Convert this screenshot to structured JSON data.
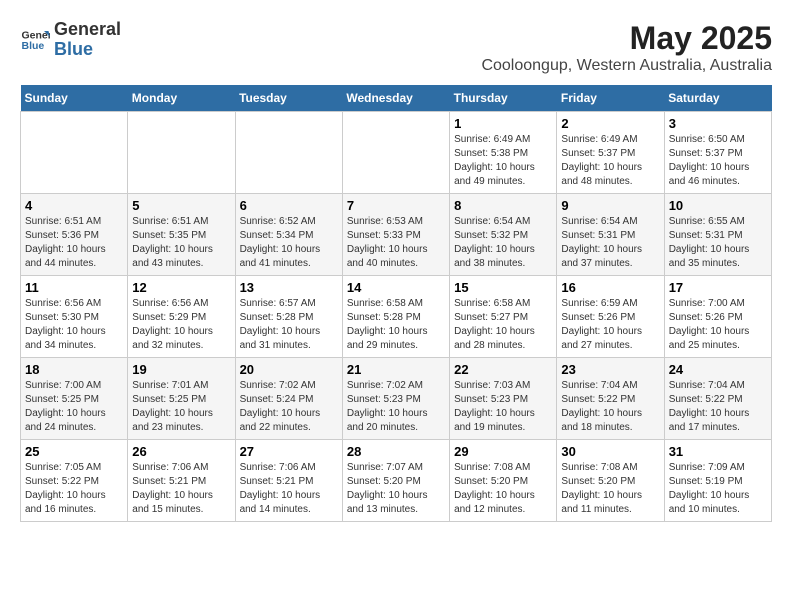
{
  "header": {
    "logo_line1": "General",
    "logo_line2": "Blue",
    "title": "May 2025",
    "subtitle": "Cooloongup, Western Australia, Australia"
  },
  "weekdays": [
    "Sunday",
    "Monday",
    "Tuesday",
    "Wednesday",
    "Thursday",
    "Friday",
    "Saturday"
  ],
  "weeks": [
    [
      {
        "day": "",
        "info": ""
      },
      {
        "day": "",
        "info": ""
      },
      {
        "day": "",
        "info": ""
      },
      {
        "day": "",
        "info": ""
      },
      {
        "day": "1",
        "info": "Sunrise: 6:49 AM\nSunset: 5:38 PM\nDaylight: 10 hours and 49 minutes."
      },
      {
        "day": "2",
        "info": "Sunrise: 6:49 AM\nSunset: 5:37 PM\nDaylight: 10 hours and 48 minutes."
      },
      {
        "day": "3",
        "info": "Sunrise: 6:50 AM\nSunset: 5:37 PM\nDaylight: 10 hours and 46 minutes."
      }
    ],
    [
      {
        "day": "4",
        "info": "Sunrise: 6:51 AM\nSunset: 5:36 PM\nDaylight: 10 hours and 44 minutes."
      },
      {
        "day": "5",
        "info": "Sunrise: 6:51 AM\nSunset: 5:35 PM\nDaylight: 10 hours and 43 minutes."
      },
      {
        "day": "6",
        "info": "Sunrise: 6:52 AM\nSunset: 5:34 PM\nDaylight: 10 hours and 41 minutes."
      },
      {
        "day": "7",
        "info": "Sunrise: 6:53 AM\nSunset: 5:33 PM\nDaylight: 10 hours and 40 minutes."
      },
      {
        "day": "8",
        "info": "Sunrise: 6:54 AM\nSunset: 5:32 PM\nDaylight: 10 hours and 38 minutes."
      },
      {
        "day": "9",
        "info": "Sunrise: 6:54 AM\nSunset: 5:31 PM\nDaylight: 10 hours and 37 minutes."
      },
      {
        "day": "10",
        "info": "Sunrise: 6:55 AM\nSunset: 5:31 PM\nDaylight: 10 hours and 35 minutes."
      }
    ],
    [
      {
        "day": "11",
        "info": "Sunrise: 6:56 AM\nSunset: 5:30 PM\nDaylight: 10 hours and 34 minutes."
      },
      {
        "day": "12",
        "info": "Sunrise: 6:56 AM\nSunset: 5:29 PM\nDaylight: 10 hours and 32 minutes."
      },
      {
        "day": "13",
        "info": "Sunrise: 6:57 AM\nSunset: 5:28 PM\nDaylight: 10 hours and 31 minutes."
      },
      {
        "day": "14",
        "info": "Sunrise: 6:58 AM\nSunset: 5:28 PM\nDaylight: 10 hours and 29 minutes."
      },
      {
        "day": "15",
        "info": "Sunrise: 6:58 AM\nSunset: 5:27 PM\nDaylight: 10 hours and 28 minutes."
      },
      {
        "day": "16",
        "info": "Sunrise: 6:59 AM\nSunset: 5:26 PM\nDaylight: 10 hours and 27 minutes."
      },
      {
        "day": "17",
        "info": "Sunrise: 7:00 AM\nSunset: 5:26 PM\nDaylight: 10 hours and 25 minutes."
      }
    ],
    [
      {
        "day": "18",
        "info": "Sunrise: 7:00 AM\nSunset: 5:25 PM\nDaylight: 10 hours and 24 minutes."
      },
      {
        "day": "19",
        "info": "Sunrise: 7:01 AM\nSunset: 5:25 PM\nDaylight: 10 hours and 23 minutes."
      },
      {
        "day": "20",
        "info": "Sunrise: 7:02 AM\nSunset: 5:24 PM\nDaylight: 10 hours and 22 minutes."
      },
      {
        "day": "21",
        "info": "Sunrise: 7:02 AM\nSunset: 5:23 PM\nDaylight: 10 hours and 20 minutes."
      },
      {
        "day": "22",
        "info": "Sunrise: 7:03 AM\nSunset: 5:23 PM\nDaylight: 10 hours and 19 minutes."
      },
      {
        "day": "23",
        "info": "Sunrise: 7:04 AM\nSunset: 5:22 PM\nDaylight: 10 hours and 18 minutes."
      },
      {
        "day": "24",
        "info": "Sunrise: 7:04 AM\nSunset: 5:22 PM\nDaylight: 10 hours and 17 minutes."
      }
    ],
    [
      {
        "day": "25",
        "info": "Sunrise: 7:05 AM\nSunset: 5:22 PM\nDaylight: 10 hours and 16 minutes."
      },
      {
        "day": "26",
        "info": "Sunrise: 7:06 AM\nSunset: 5:21 PM\nDaylight: 10 hours and 15 minutes."
      },
      {
        "day": "27",
        "info": "Sunrise: 7:06 AM\nSunset: 5:21 PM\nDaylight: 10 hours and 14 minutes."
      },
      {
        "day": "28",
        "info": "Sunrise: 7:07 AM\nSunset: 5:20 PM\nDaylight: 10 hours and 13 minutes."
      },
      {
        "day": "29",
        "info": "Sunrise: 7:08 AM\nSunset: 5:20 PM\nDaylight: 10 hours and 12 minutes."
      },
      {
        "day": "30",
        "info": "Sunrise: 7:08 AM\nSunset: 5:20 PM\nDaylight: 10 hours and 11 minutes."
      },
      {
        "day": "31",
        "info": "Sunrise: 7:09 AM\nSunset: 5:19 PM\nDaylight: 10 hours and 10 minutes."
      }
    ]
  ]
}
